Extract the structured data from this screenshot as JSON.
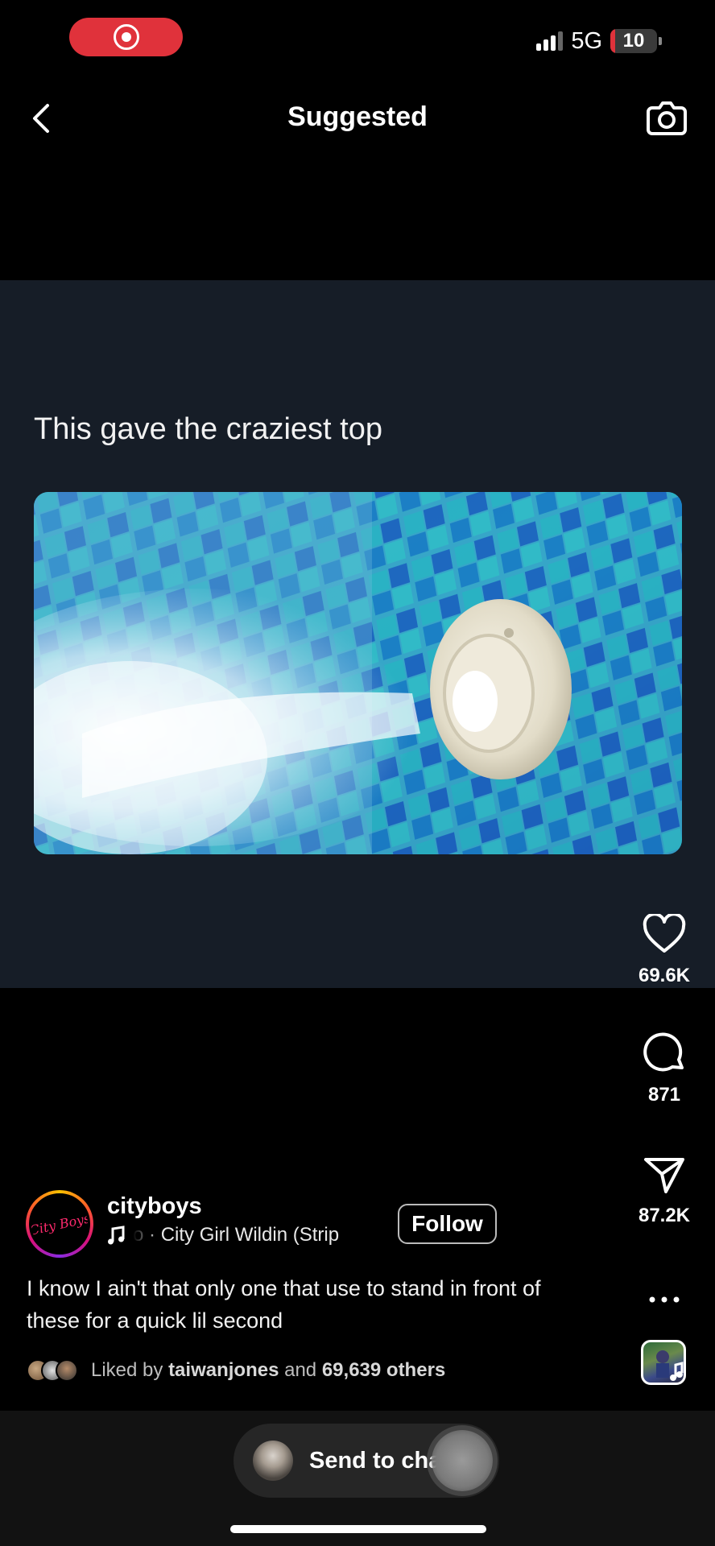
{
  "status_bar": {
    "network": "5G",
    "battery": "10",
    "battery_level": 0.1,
    "signal_bars": 3,
    "recording": true,
    "record_color": "#e0323b"
  },
  "header": {
    "title": "Suggested",
    "back_icon": "chevron-left-icon",
    "camera_icon": "camera-icon"
  },
  "post": {
    "headline": "This gave the craziest top",
    "account": {
      "username": "cityboys",
      "audio_prefix": "o",
      "audio_separator": "·",
      "audio_title": "City Girl Wildin (Strip",
      "follow_label": "Follow"
    },
    "caption": "I know I ain't that only one that use to stand in front of these for a quick lil second",
    "likes": {
      "prefix": "Liked by",
      "user": "taiwanjones",
      "middle": "and",
      "others": "69,639 others"
    }
  },
  "actions": {
    "like_count": "69.6K",
    "comment_count": "871",
    "share_count": "87.2K"
  },
  "bottom": {
    "send_label": "Send to chat"
  },
  "colors": {
    "card_background": "#161d27",
    "accent": "#e0323b"
  }
}
